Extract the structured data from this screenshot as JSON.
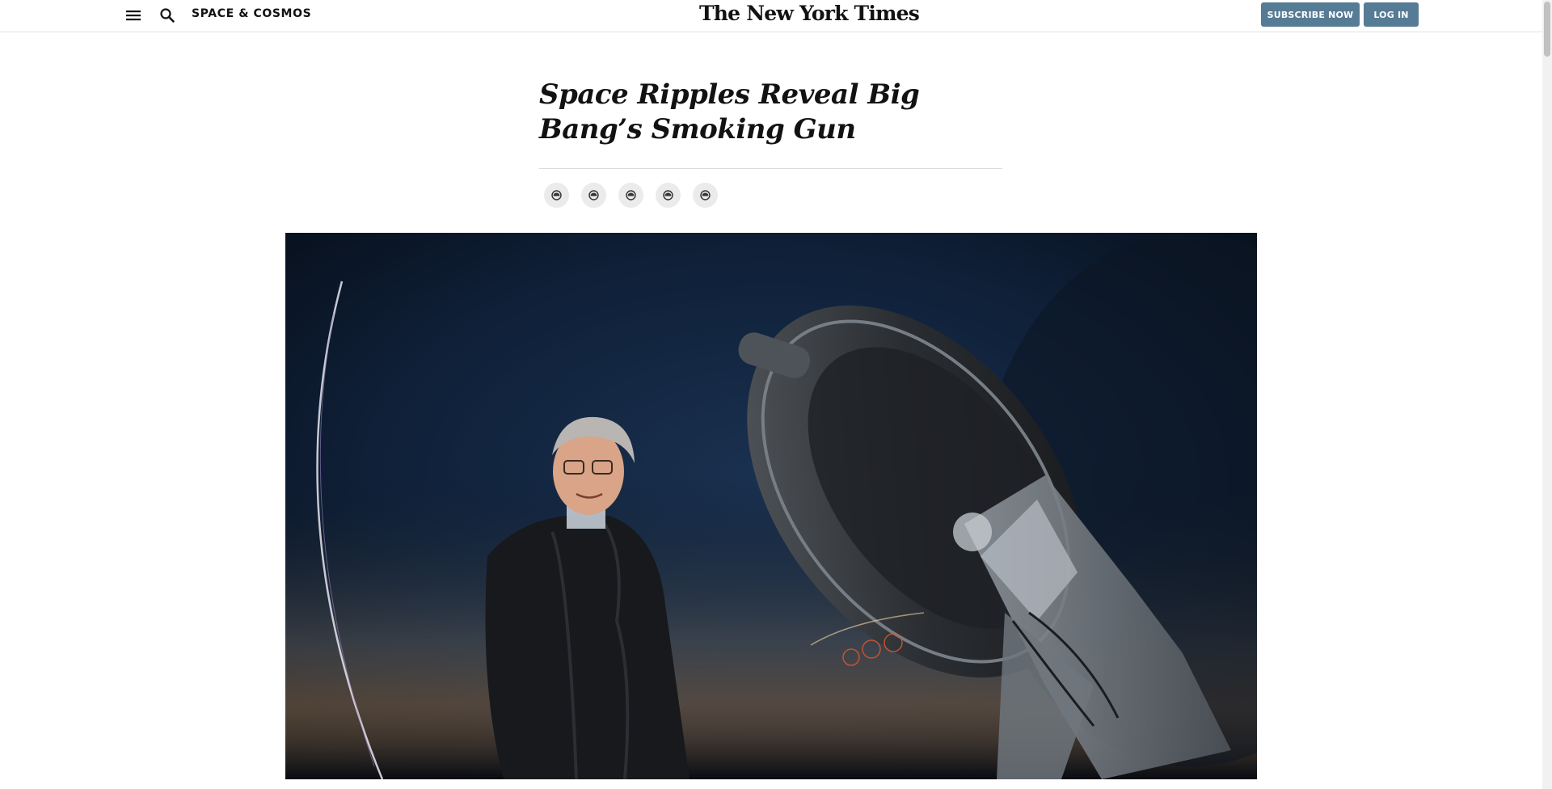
{
  "masthead": {
    "section_label": "SPACE & COSMOS",
    "logo_text": "The New York Times",
    "subscribe_label": "SUBSCRIBE NOW",
    "login_label": "LOG IN",
    "icons": [
      "menu-icon",
      "search-icon"
    ],
    "button_color": "#567b95"
  },
  "article": {
    "headline": "Space Ripples Reveal Big Bang’s Smoking Gun",
    "share_buttons": [
      {
        "name": "share-icon"
      },
      {
        "name": "share-icon"
      },
      {
        "name": "share-icon"
      },
      {
        "name": "share-icon"
      },
      {
        "name": "share-icon"
      }
    ]
  }
}
